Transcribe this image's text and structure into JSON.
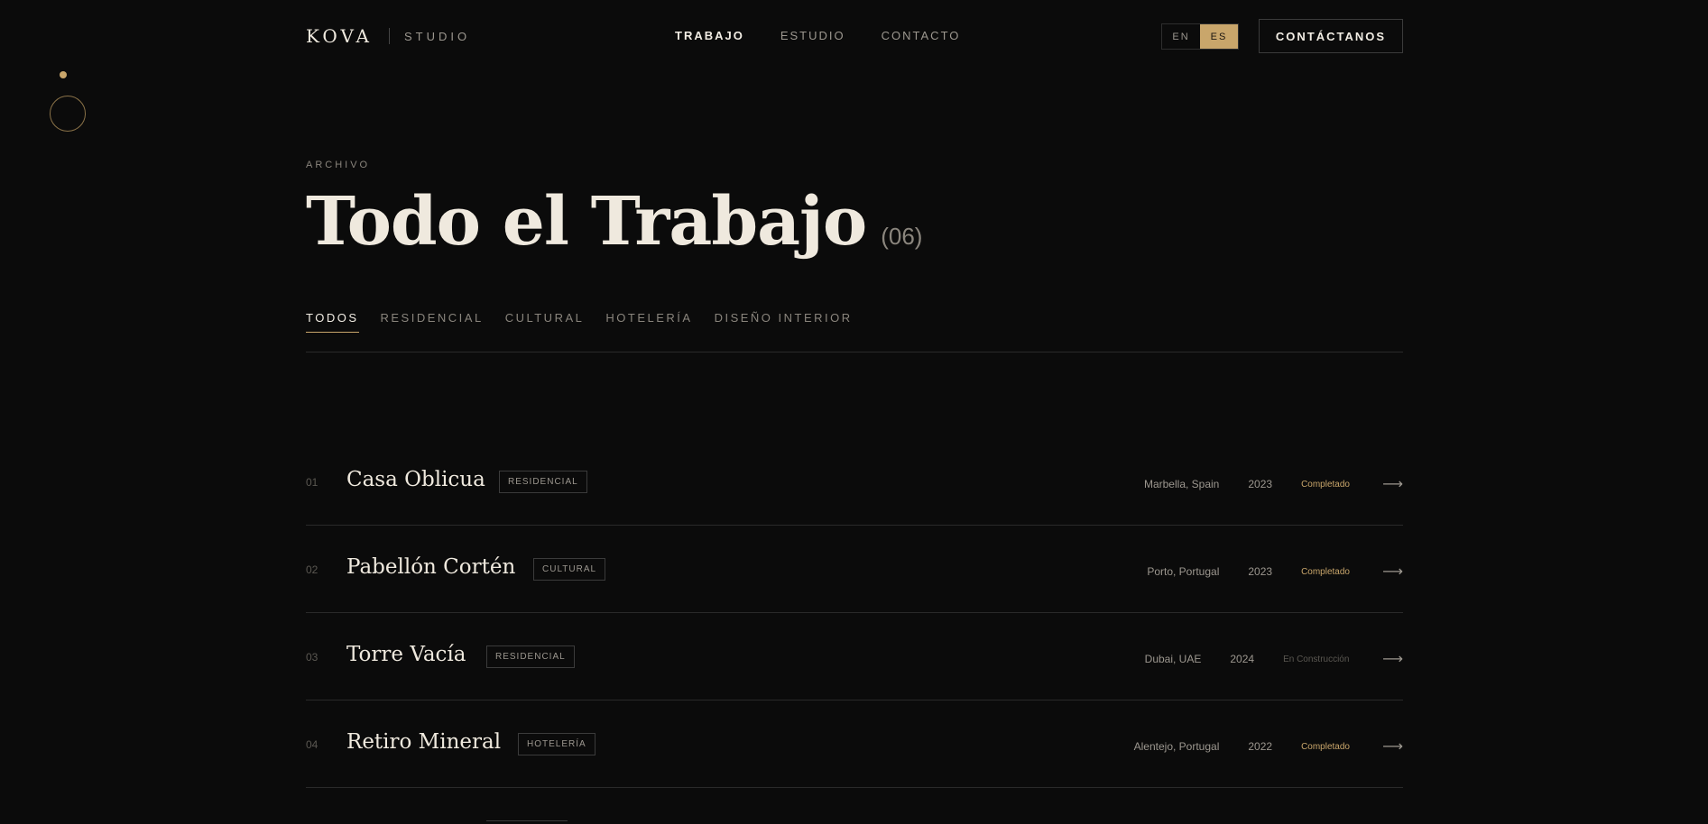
{
  "header": {
    "logo": "KOVA",
    "studio": "STUDIO",
    "nav": [
      "TRABAJO",
      "ESTUDIO",
      "CONTACTO"
    ],
    "active_nav": "TRABAJO",
    "languages": [
      "EN",
      "ES"
    ],
    "active_language": "ES",
    "cta": "CONTÁCTANOS"
  },
  "hero": {
    "eyebrow": "ARCHIVO",
    "title": "Todo el Trabajo",
    "count": "(06)"
  },
  "filters": {
    "items": [
      "TODOS",
      "RESIDENCIAL",
      "CULTURAL",
      "HOTELERÍA",
      "DISEÑO INTERIOR"
    ],
    "active": "TODOS"
  },
  "projects": [
    {
      "num": "01",
      "name": "Casa Oblicua",
      "tag": "RESIDENCIAL",
      "location": "Marbella, Spain",
      "year": "2023",
      "status": "Completado",
      "arrow": "⟶"
    },
    {
      "num": "02",
      "name": "Pabellón Cortén",
      "tag": "CULTURAL",
      "location": "Porto, Portugal",
      "year": "2023",
      "status": "Completado",
      "arrow": "⟶"
    },
    {
      "num": "03",
      "name": "Torre Vacía",
      "tag": "RESIDENCIAL",
      "location": "Dubai, UAE",
      "year": "2024",
      "status": "En Construcción",
      "arrow": "⟶"
    },
    {
      "num": "04",
      "name": "Retiro Mineral",
      "tag": "HOTELERÍA",
      "location": "Alentejo, Portugal",
      "year": "2022",
      "status": "Completado",
      "arrow": "⟶"
    }
  ],
  "colors": {
    "background": "#0b0b0b",
    "accent": "#c9a66b",
    "text": "#efe9de",
    "muted": "#9c978f"
  }
}
